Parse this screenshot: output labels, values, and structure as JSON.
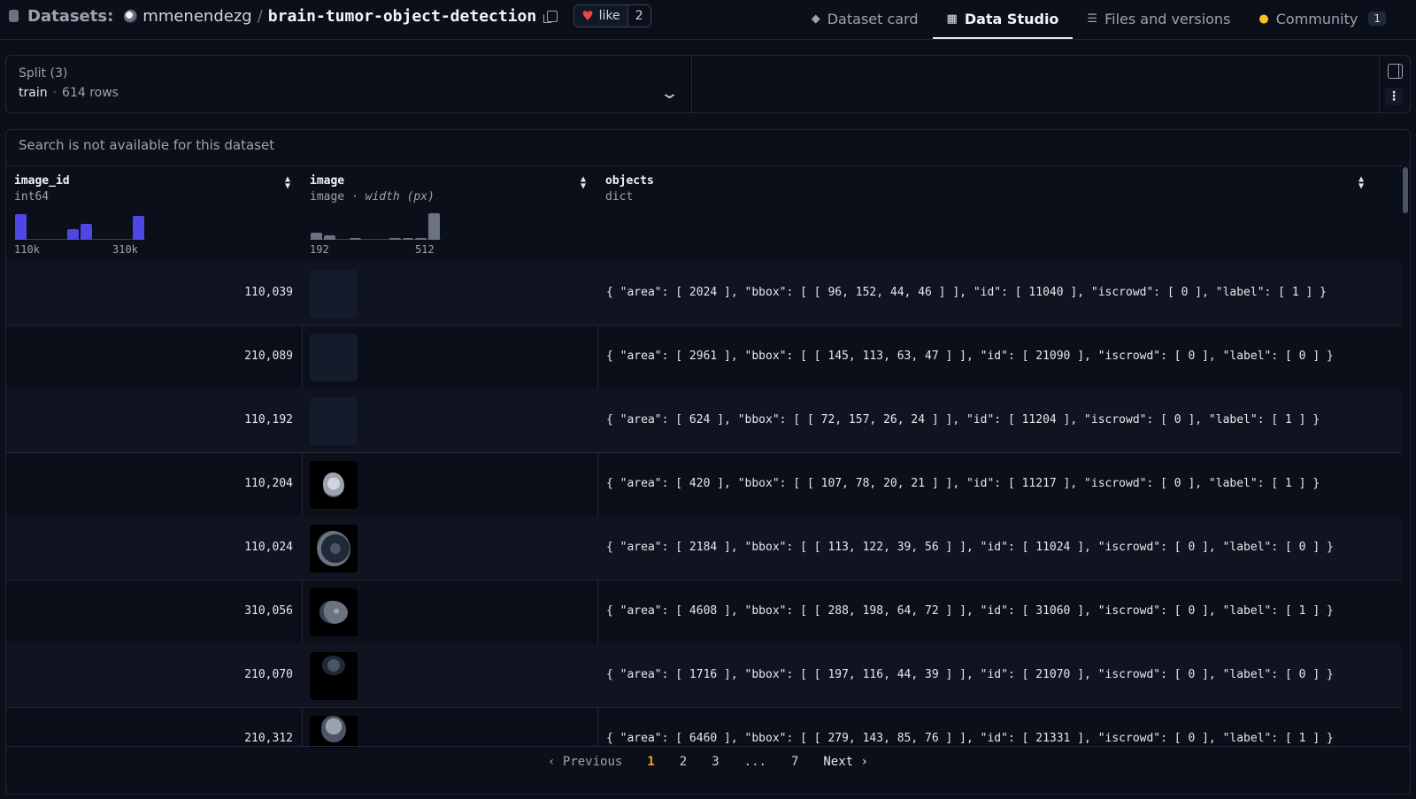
{
  "header": {
    "section_label": "Datasets:",
    "owner": "mmenendezg",
    "slash": "/",
    "repo": "brain-tumor-object-detection",
    "like_label": "like",
    "like_count": "2"
  },
  "tabs": [
    {
      "label": "Dataset card",
      "icon": "cube-icon"
    },
    {
      "label": "Data Studio",
      "icon": "table-icon",
      "active": true
    },
    {
      "label": "Files and versions",
      "icon": "files-icon"
    },
    {
      "label": "Community",
      "icon": "community-emoji-icon",
      "badge": "1"
    }
  ],
  "split": {
    "label": "Split (3)",
    "value": "train",
    "separator": "·",
    "rows": "614 rows"
  },
  "search_message": "Search is not available for this dataset",
  "columns": [
    {
      "name": "image_id",
      "type": "int64",
      "hist_min": "110k",
      "hist_max": "310k",
      "hist_values": [
        0.95,
        0,
        0,
        0,
        0.4,
        0.6,
        0,
        0,
        0,
        0.9
      ]
    },
    {
      "name": "image",
      "type": "image",
      "type_sep": "·",
      "type_extra": "width (px)",
      "hist_min": "192",
      "hist_max": "512",
      "hist_values": [
        0.25,
        0.18,
        0,
        0.08,
        0,
        0,
        0.08,
        0.08,
        0.08,
        1.0
      ]
    },
    {
      "name": "objects",
      "type": "dict"
    }
  ],
  "rows": [
    {
      "image_id": "110,039",
      "thumb": "loading",
      "objects": "{ \"area\": [ 2024 ], \"bbox\": [ [ 96, 152, 44, 46 ] ], \"id\": [ 11040 ], \"iscrowd\": [ 0 ], \"label\": [ 1 ] }"
    },
    {
      "image_id": "210,089",
      "thumb": "loading",
      "objects": "{ \"area\": [ 2961 ], \"bbox\": [ [ 145, 113, 63, 47 ] ], \"id\": [ 21090 ], \"iscrowd\": [ 0 ], \"label\": [ 0 ] }"
    },
    {
      "image_id": "110,192",
      "thumb": "loading",
      "objects": "{ \"area\": [ 624 ], \"bbox\": [ [ 72, 157, 26, 24 ] ], \"id\": [ 11204 ], \"iscrowd\": [ 0 ], \"label\": [ 1 ] }"
    },
    {
      "image_id": "110,204",
      "thumb": "brain",
      "objects": "{ \"area\": [ 420 ], \"bbox\": [ [ 107, 78, 20, 21 ] ], \"id\": [ 11217 ], \"iscrowd\": [ 0 ], \"label\": [ 1 ] }"
    },
    {
      "image_id": "110,024",
      "thumb": "brain",
      "objects": "{ \"area\": [ 2184 ], \"bbox\": [ [ 113, 122, 39, 56 ] ], \"id\": [ 11024 ], \"iscrowd\": [ 0 ], \"label\": [ 0 ] }"
    },
    {
      "image_id": "310,056",
      "thumb": "brain",
      "objects": "{ \"area\": [ 4608 ], \"bbox\": [ [ 288, 198, 64, 72 ] ], \"id\": [ 31060 ], \"iscrowd\": [ 0 ], \"label\": [ 1 ] }"
    },
    {
      "image_id": "210,070",
      "thumb": "brain",
      "objects": "{ \"area\": [ 1716 ], \"bbox\": [ [ 197, 116, 44, 39 ] ], \"id\": [ 21070 ], \"iscrowd\": [ 0 ], \"label\": [ 0 ] }"
    },
    {
      "image_id": "210,312",
      "thumb": "brain",
      "objects": "{ \"area\": [ 6460 ], \"bbox\": [ [ 279, 143, 85, 76 ] ], \"id\": [ 21331 ], \"iscrowd\": [ 0 ], \"label\": [ 1 ] }"
    }
  ],
  "pagination": {
    "previous": "Previous",
    "pages": [
      "1",
      "2",
      "3"
    ],
    "ellipsis": "...",
    "last": "7",
    "next": "Next",
    "current": "1"
  },
  "colors": {
    "background": "#0b0f19",
    "accent": "#f59e0b",
    "hist_id": "#4f46e5",
    "hist_image": "#6b7280",
    "like_heart": "#ef4444"
  }
}
